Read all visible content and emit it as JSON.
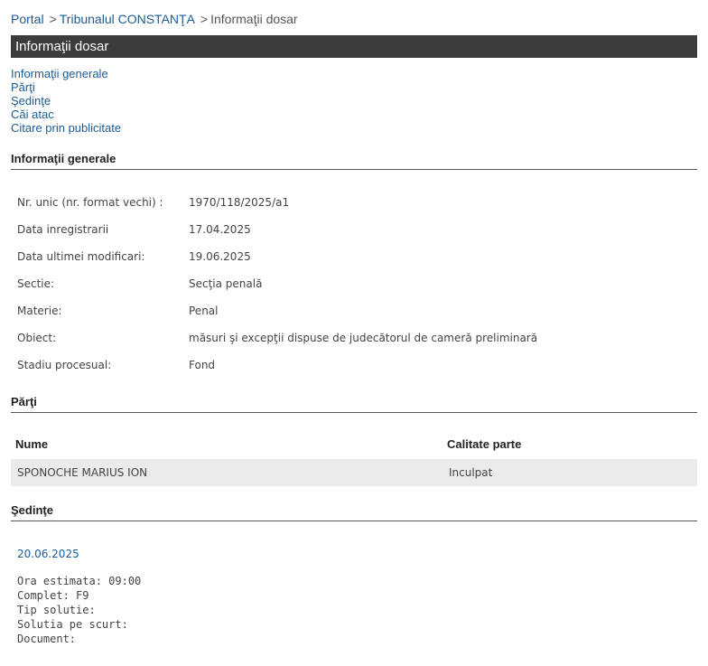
{
  "breadcrumb": {
    "portal": "Portal",
    "sep1": ">",
    "court": "Tribunalul CONSTANŢA",
    "sep2": ">",
    "current": "Informaţii dosar"
  },
  "title": "Informaţii dosar",
  "anchors": [
    "Informaţii generale",
    "Părţi",
    "Şedinţe",
    "Căi atac",
    "Citare prin publicitate"
  ],
  "general": {
    "header": "Informaţii generale",
    "rows": [
      {
        "label": "Nr. unic (nr. format vechi) :",
        "value": "1970/118/2025/a1"
      },
      {
        "label": "Data inregistrarii",
        "value": "17.04.2025"
      },
      {
        "label": "Data ultimei modificari:",
        "value": "19.06.2025"
      },
      {
        "label": "Sectie:",
        "value": "Secţia penală"
      },
      {
        "label": "Materie:",
        "value": "Penal"
      },
      {
        "label": "Obiect:",
        "value": "măsuri şi excepţii dispuse de judecătorul de cameră preliminară"
      },
      {
        "label": "Stadiu procesual:",
        "value": "Fond"
      }
    ]
  },
  "parties": {
    "header": "Părţi",
    "columns": [
      "Nume",
      "Calitate parte"
    ],
    "rows": [
      {
        "name": "SPONOCHE MARIUS ION",
        "role": "Inculpat"
      }
    ]
  },
  "sessions": {
    "header": "Şedinţe",
    "date": "20.06.2025",
    "details": [
      "Ora estimata: 09:00",
      "Complet: F9",
      "Tip solutie:",
      "Solutia pe scurt:",
      "Document:"
    ]
  }
}
